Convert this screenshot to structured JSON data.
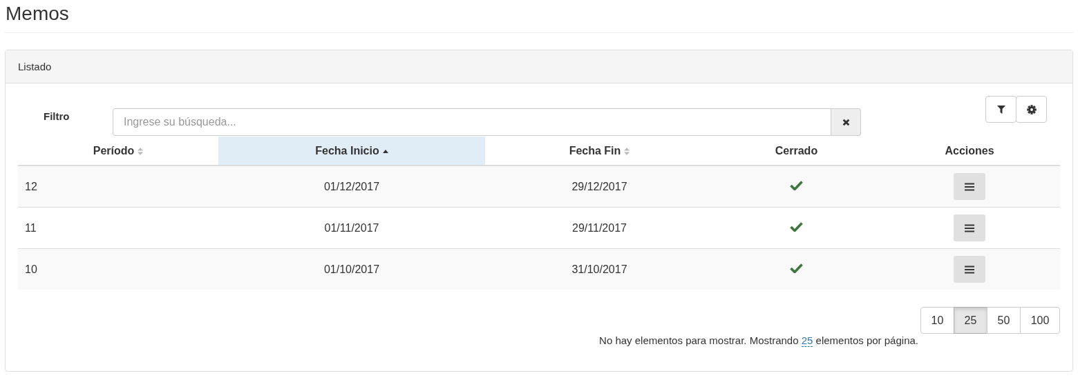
{
  "page_title": "Memos",
  "panel": {
    "heading": "Listado",
    "filter": {
      "label": "Filtro",
      "placeholder": "Ingrese su búsqueda..."
    },
    "table": {
      "columns": [
        {
          "label": "Período",
          "sortable": true,
          "sorted_ascending": false
        },
        {
          "label": "Fecha Inicio",
          "sortable": true,
          "sorted_ascending": true
        },
        {
          "label": "Fecha Fin",
          "sortable": true,
          "sorted_ascending": false
        },
        {
          "label": "Cerrado",
          "sortable": false,
          "sorted_ascending": false
        },
        {
          "label": "Acciones",
          "sortable": false,
          "sorted_ascending": false
        }
      ],
      "rows": [
        {
          "periodo": "12",
          "inicio": "01/12/2017",
          "fin": "29/12/2017",
          "cerrado": true
        },
        {
          "periodo": "11",
          "inicio": "01/11/2017",
          "fin": "29/11/2017",
          "cerrado": true
        },
        {
          "periodo": "10",
          "inicio": "01/10/2017",
          "fin": "31/10/2017",
          "cerrado": true
        }
      ]
    },
    "page_sizes": [
      {
        "label": "10",
        "selected": false
      },
      {
        "label": "25",
        "selected": true
      },
      {
        "label": "50",
        "selected": false
      },
      {
        "label": "100",
        "selected": false
      }
    ],
    "footer": {
      "before": "No hay elementos para mostrar. Mostrando",
      "link": "25",
      "after": "elementos por página."
    }
  }
}
